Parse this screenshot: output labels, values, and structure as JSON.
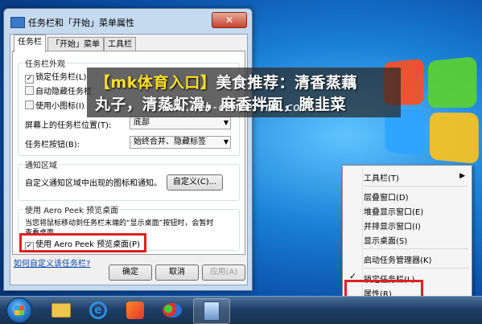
{
  "dialog": {
    "title": "任务栏和「开始」菜单属性",
    "close_label": "✕",
    "tabs": [
      "任务栏",
      "「开始」菜单",
      "工具栏"
    ],
    "appearance": {
      "legend": "任务栏外观",
      "lock": "锁定任务栏(L)",
      "autohide": "自动隐藏任务栏",
      "small_icons": "使用小图标(I)",
      "location_label": "屏幕上的任务栏位置(T):",
      "location_value": "底部",
      "buttons_label": "任务栏按钮(B):",
      "buttons_value": "始终合并、隐藏标签"
    },
    "notify": {
      "legend": "通知区域",
      "desc": "自定义通知区域中出现的图标和通知。",
      "customize_button": "自定义(C)..."
    },
    "peek": {
      "legend": "使用 Aero Peek 预览桌面",
      "desc_line1": "当您将鼠标移动到任务栏末端的“显示桌面”按钮时，会暂时",
      "desc_line2": "查看桌面。",
      "checkbox": "使用 Aero Peek 预览桌面(P)"
    },
    "help_link": "如何自定义该任务栏?",
    "ok": "确定",
    "cancel": "取消",
    "apply": "应用(A)",
    "check_mark": "✓"
  },
  "banner": {
    "title_bracket": "【mk体育入口】",
    "title_rest": "美食推荐：清香蒸藕",
    "title_line2": "丸子，清蒸虾滑，麻香拌面，腌韭菜",
    "url": "www.web-center-mk.com"
  },
  "context_menu": {
    "items": [
      "工具栏(T)",
      "层叠窗口(D)",
      "堆叠显示窗口(E)",
      "并排显示窗口(I)",
      "显示桌面(S)",
      "启动任务管理器(K)",
      "锁定任务栏(L)",
      "属性(R)"
    ],
    "submenu_arrow": "▶",
    "check": "✓"
  },
  "taskbar": {
    "ie_glyph": "e"
  }
}
